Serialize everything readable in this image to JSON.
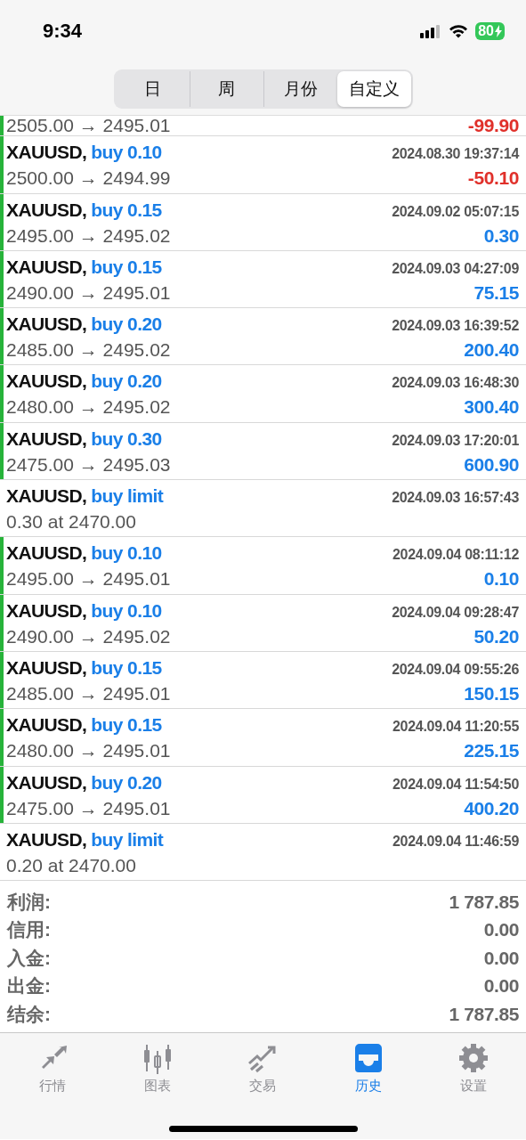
{
  "status_bar": {
    "time": "9:34",
    "battery": "80"
  },
  "segments": [
    {
      "label": "日",
      "selected": false
    },
    {
      "label": "周",
      "selected": false
    },
    {
      "label": "月份",
      "selected": false
    },
    {
      "label": "自定义",
      "selected": true
    }
  ],
  "rows": [
    {
      "kind": "partial",
      "prices": "2505.00 → 2495.01",
      "profit": "-99.90",
      "color": "#e0302a"
    },
    {
      "kind": "position",
      "symbol": "XAUUSD,",
      "side": "buy 0.10",
      "time": "2024.08.30 19:37:14",
      "prices": "2500.00 → 2494.99",
      "profit": "-50.10",
      "color": "#e0302a"
    },
    {
      "kind": "position",
      "symbol": "XAUUSD,",
      "side": "buy 0.15",
      "time": "2024.09.02 05:07:15",
      "prices": "2495.00 → 2495.02",
      "profit": "0.30",
      "color": "#1a7fe8"
    },
    {
      "kind": "position",
      "symbol": "XAUUSD,",
      "side": "buy 0.15",
      "time": "2024.09.03 04:27:09",
      "prices": "2490.00 → 2495.01",
      "profit": "75.15",
      "color": "#1a7fe8"
    },
    {
      "kind": "position",
      "symbol": "XAUUSD,",
      "side": "buy 0.20",
      "time": "2024.09.03 16:39:52",
      "prices": "2485.00 → 2495.02",
      "profit": "200.40",
      "color": "#1a7fe8"
    },
    {
      "kind": "position",
      "symbol": "XAUUSD,",
      "side": "buy 0.20",
      "time": "2024.09.03 16:48:30",
      "prices": "2480.00 → 2495.02",
      "profit": "300.40",
      "color": "#1a7fe8"
    },
    {
      "kind": "position",
      "symbol": "XAUUSD,",
      "side": "buy 0.30",
      "time": "2024.09.03 17:20:01",
      "prices": "2475.00 → 2495.03",
      "profit": "600.90",
      "color": "#1a7fe8"
    },
    {
      "kind": "order",
      "symbol": "XAUUSD,",
      "side": "buy limit",
      "time": "2024.09.03 16:57:43",
      "prices": "0.30 at 2470.00"
    },
    {
      "kind": "position",
      "symbol": "XAUUSD,",
      "side": "buy 0.10",
      "time": "2024.09.04 08:11:12",
      "prices": "2495.00 → 2495.01",
      "profit": "0.10",
      "color": "#1a7fe8"
    },
    {
      "kind": "position",
      "symbol": "XAUUSD,",
      "side": "buy 0.10",
      "time": "2024.09.04 09:28:47",
      "prices": "2490.00 → 2495.02",
      "profit": "50.20",
      "color": "#1a7fe8"
    },
    {
      "kind": "position",
      "symbol": "XAUUSD,",
      "side": "buy 0.15",
      "time": "2024.09.04 09:55:26",
      "prices": "2485.00 → 2495.01",
      "profit": "150.15",
      "color": "#1a7fe8"
    },
    {
      "kind": "position",
      "symbol": "XAUUSD,",
      "side": "buy 0.15",
      "time": "2024.09.04 11:20:55",
      "prices": "2480.00 → 2495.01",
      "profit": "225.15",
      "color": "#1a7fe8"
    },
    {
      "kind": "position",
      "symbol": "XAUUSD,",
      "side": "buy 0.20",
      "time": "2024.09.04 11:54:50",
      "prices": "2475.00 → 2495.01",
      "profit": "400.20",
      "color": "#1a7fe8"
    },
    {
      "kind": "order",
      "symbol": "XAUUSD,",
      "side": "buy limit",
      "time": "2024.09.04 11:46:59",
      "prices": "0.20 at 2470.00"
    }
  ],
  "summary": [
    {
      "label": "利润:",
      "value": "1 787.85"
    },
    {
      "label": "信用:",
      "value": "0.00"
    },
    {
      "label": "入金:",
      "value": "0.00"
    },
    {
      "label": "出金:",
      "value": "0.00"
    },
    {
      "label": "结余:",
      "value": "1 787.85"
    }
  ],
  "tab_bar": [
    {
      "kind": "quotes",
      "label": "行情",
      "selected": false
    },
    {
      "kind": "chart",
      "label": "图表",
      "selected": false
    },
    {
      "kind": "trade",
      "label": "交易",
      "selected": false
    },
    {
      "kind": "history",
      "label": "历史",
      "selected": true
    },
    {
      "kind": "settings",
      "label": "设置",
      "selected": false
    }
  ]
}
